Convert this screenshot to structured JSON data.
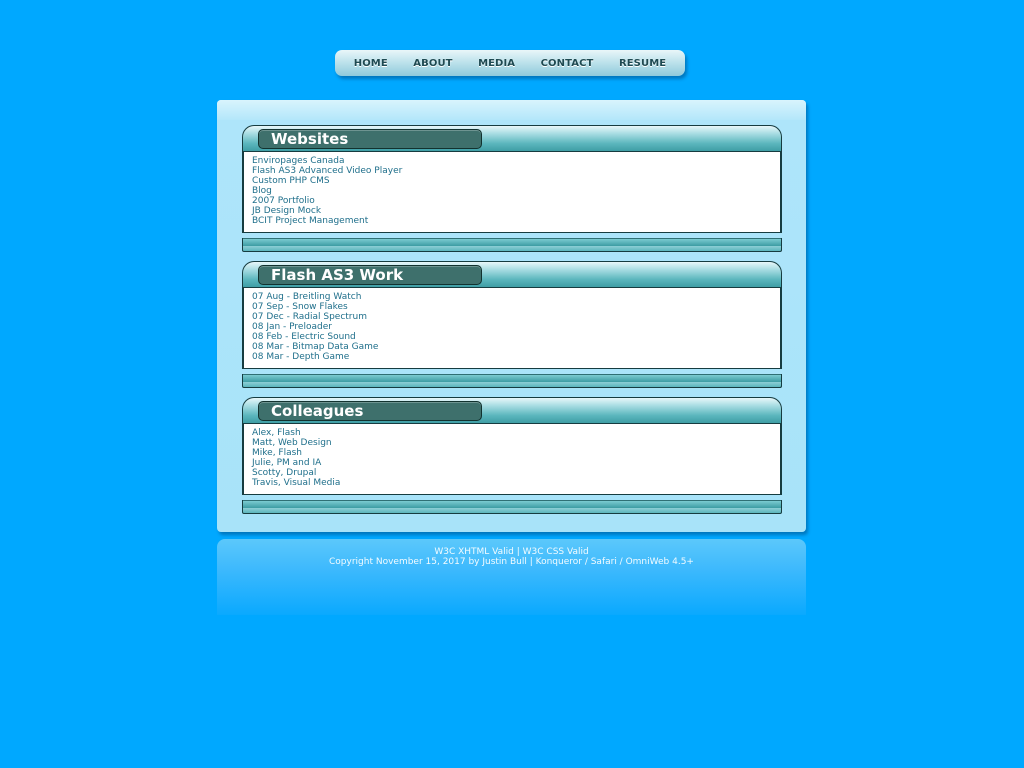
{
  "nav": {
    "items": [
      "HOME",
      "ABOUT",
      "MEDIA",
      "CONTACT",
      "RESUME"
    ]
  },
  "panels": [
    {
      "title": "Websites",
      "links": [
        "Enviropages Canada",
        "Flash AS3 Advanced Video Player",
        "Custom PHP CMS",
        "Blog",
        "2007 Portfolio",
        "JB Design Mock",
        "BCIT Project Management"
      ]
    },
    {
      "title": "Flash AS3 Work",
      "links": [
        "07 Aug - Breitling Watch",
        "07 Sep - Snow Flakes",
        "07 Dec - Radial Spectrum",
        "08 Jan - Preloader",
        "08 Feb - Electric Sound",
        "08 Mar - Bitmap Data Game",
        "08 Mar - Depth Game"
      ]
    },
    {
      "title": "Colleagues",
      "links": [
        "Alex, Flash",
        "Matt, Web Design",
        "Mike, Flash",
        "Julie, PM and IA",
        "Scotty, Drupal",
        "Travis, Visual Media"
      ]
    }
  ],
  "footer": {
    "xhtml_link": "W3C XHTML Valid",
    "separator": "|",
    "css_link": "W3C CSS Valid",
    "copyright": "Copyright November 15, 2017 by Justin Bull | Konqueror / Safari / OmniWeb 4.5+"
  },
  "colors": {
    "page_background": "#00a8ff",
    "link": "#1f6f8b",
    "title_bar": "#3e706c"
  }
}
